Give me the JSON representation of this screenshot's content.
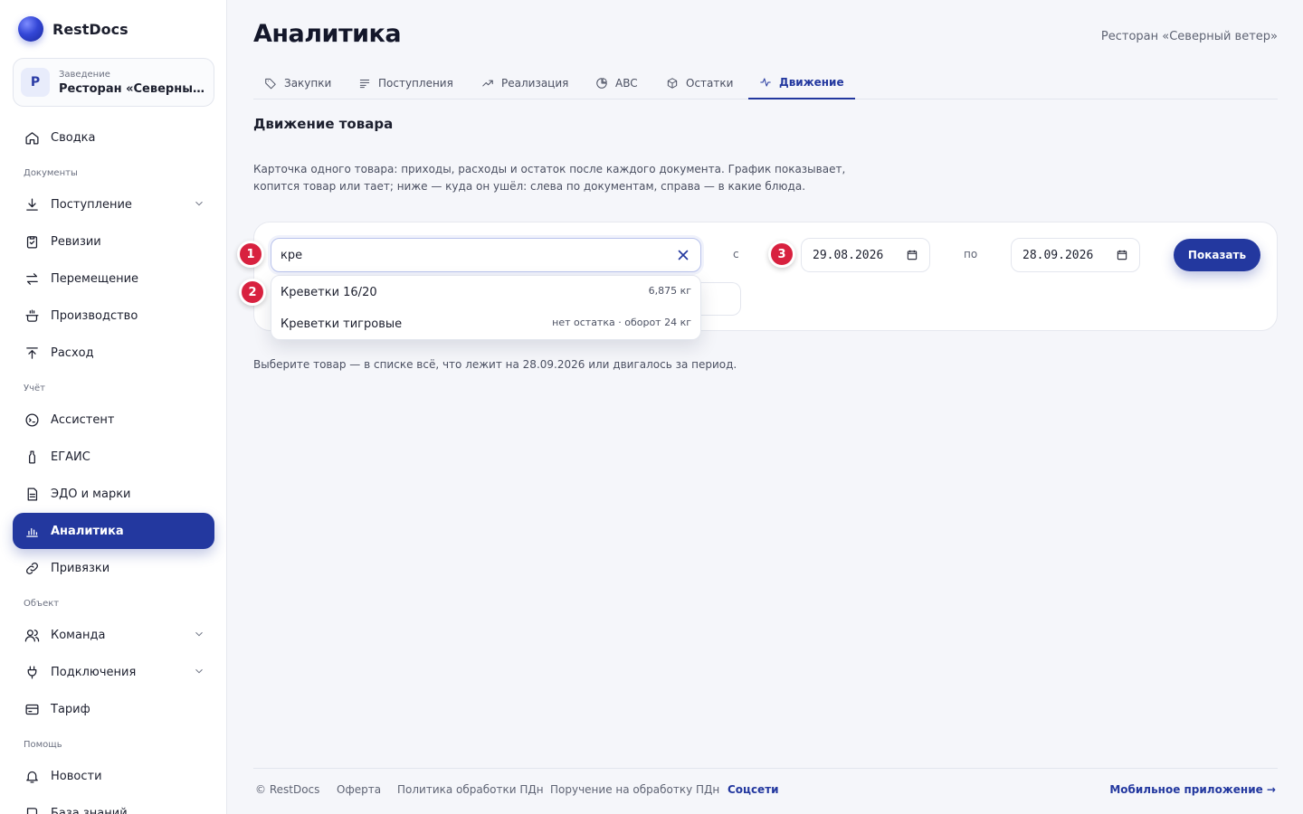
{
  "brand": {
    "name": "RestDocs"
  },
  "venue_switch": {
    "label": "Заведение",
    "name": "Ресторан «Северный ветер»"
  },
  "nav": {
    "summary": "Сводка",
    "sections": {
      "documents": "Документы",
      "accounting": "Учёт",
      "object": "Объект",
      "help": "Помощь"
    },
    "receipt": "Поступление",
    "revisions": "Ревизии",
    "transfer": "Перемещение",
    "production": "Производство",
    "expense": "Расход",
    "assistant": "Ассистент",
    "egais": "ЕГАИС",
    "edo": "ЭДО и марки",
    "analytics": "Аналитика",
    "bindings": "Привязки",
    "team": "Команда",
    "connections": "Подключения",
    "tariff": "Тариф",
    "news": "Новости",
    "knowledge": "База знаний"
  },
  "header": {
    "title": "Аналитика",
    "venue": "Ресторан «Северный ветер»"
  },
  "tabs": [
    {
      "label": "Закупки",
      "icon": "tag-icon"
    },
    {
      "label": "Поступления",
      "icon": "list-icon"
    },
    {
      "label": "Реализация",
      "icon": "trend-up-icon"
    },
    {
      "label": "ABC",
      "icon": "pie-icon"
    },
    {
      "label": "Остатки",
      "icon": "box-icon"
    },
    {
      "label": "Движение",
      "icon": "pulse-icon",
      "active": true
    }
  ],
  "section": {
    "title": "Движение товара",
    "description": "Карточка одного товара: приходы, расходы и остаток после каждого документа. График показывает, копится товар или тает; ниже — куда он ушёл: слева по документам, справа — в какие блюда."
  },
  "filter": {
    "search_value": "кре",
    "suggestions": [
      {
        "name": "Креветки 16/20",
        "meta": "6,875 кг"
      },
      {
        "name": "Креветки тигровые",
        "meta": "нет остатка · оборот 24 кг"
      }
    ],
    "from_label": "с",
    "date_from": "29.08.2026",
    "to_label": "по",
    "date_to": "28.09.2026",
    "show_label": "Показать"
  },
  "markers": [
    "1",
    "2",
    "3"
  ],
  "hint": "Выберите товар — в списке всё, что лежит на 28.09.2026 или двигалось за период.",
  "footer": {
    "copyright": "© RestDocs",
    "offer": "Оферта",
    "privacy": "Политика обработки ПДн",
    "assignment": "Поручение на обработку ПДн",
    "social": "Соцсети",
    "mobile": "Мобильное приложение →"
  },
  "colors": {
    "accent": "#23389f",
    "marker": "#d8213f"
  }
}
